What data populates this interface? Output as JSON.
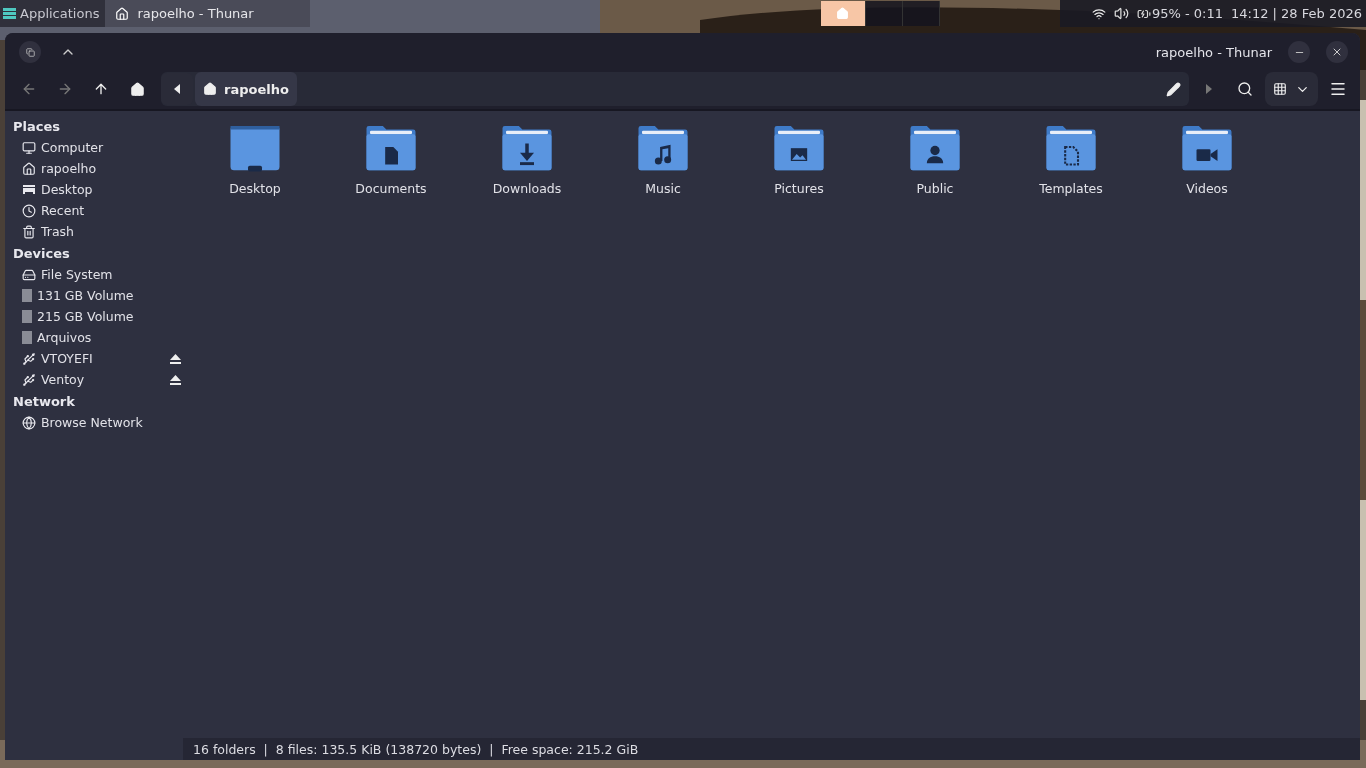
{
  "taskbar": {
    "menu": "Applications",
    "tasks": [
      {
        "label": "rapoelho - Thunar",
        "selected": true
      }
    ],
    "workspaces": [
      {
        "selected": true
      },
      {
        "selected": false
      },
      {
        "selected": false
      }
    ],
    "battery": "95% - 0:11",
    "clock": "14:12 | 28 Feb 2026"
  },
  "window": {
    "title": "rapoelho - Thunar"
  },
  "path_bar": {
    "crumbs": [
      {
        "label": "rapoelho",
        "selected": true
      }
    ]
  },
  "sidebar": {
    "sections": [
      {
        "title": "Places",
        "items": [
          {
            "kind": "computer",
            "label": "Computer",
            "eject": false
          },
          {
            "kind": "home",
            "label": "rapoelho",
            "eject": false
          },
          {
            "kind": "desktop",
            "label": "Desktop",
            "eject": false
          },
          {
            "kind": "recent",
            "label": "Recent",
            "eject": false
          },
          {
            "kind": "trash",
            "label": "Trash",
            "eject": false
          }
        ]
      },
      {
        "title": "Devices",
        "items": [
          {
            "kind": "filesystem",
            "label": "File System",
            "eject": false
          },
          {
            "kind": "volume",
            "label": "131 GB Volume",
            "eject": false
          },
          {
            "kind": "volume",
            "label": "215 GB Volume",
            "eject": false
          },
          {
            "kind": "volume",
            "label": "Arquivos",
            "eject": false
          },
          {
            "kind": "usb",
            "label": "VTOYEFI",
            "eject": true
          },
          {
            "kind": "usb",
            "label": "Ventoy",
            "eject": true
          }
        ]
      },
      {
        "title": "Network",
        "items": [
          {
            "kind": "network",
            "label": "Browse Network",
            "eject": false
          }
        ]
      }
    ]
  },
  "folders": [
    {
      "kind": "desktop",
      "label": "Desktop"
    },
    {
      "kind": "documents",
      "label": "Documents"
    },
    {
      "kind": "downloads",
      "label": "Downloads"
    },
    {
      "kind": "music",
      "label": "Music"
    },
    {
      "kind": "pictures",
      "label": "Pictures"
    },
    {
      "kind": "public",
      "label": "Public"
    },
    {
      "kind": "templates",
      "label": "Templates"
    },
    {
      "kind": "videos",
      "label": "Videos"
    }
  ],
  "status_bar": "16 folders  |  8 files: 135.5 KiB (138720 bytes)  |  Free space: 215.2 GiB"
}
